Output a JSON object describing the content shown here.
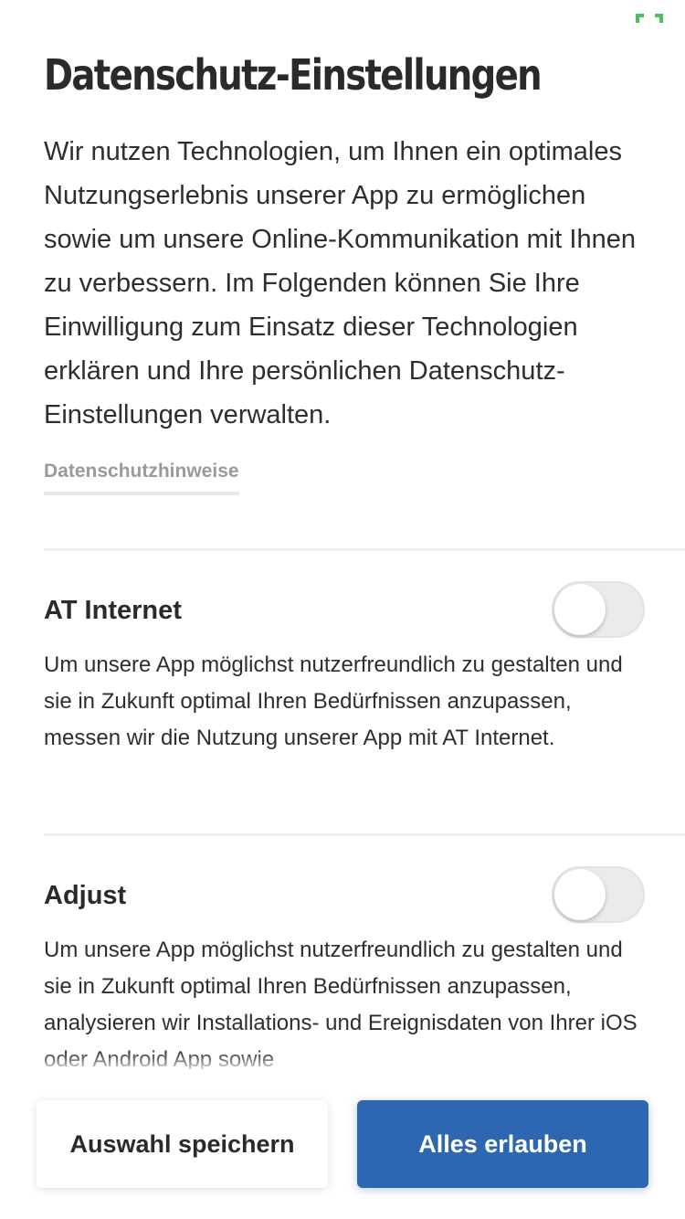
{
  "status": {
    "icon": "expand-icon",
    "color": "#4cc05a"
  },
  "page": {
    "title": "Datenschutz-Einstellungen",
    "intro": "Wir nutzen Technologien, um Ihnen ein optimales Nutzungserlebnis unserer App zu ermöglichen sowie um unsere Online-Kommunikation mit Ihnen zu verbessern. Im Folgenden können  Sie Ihre Einwilligung zum Einsatz dieser Technologien erklären und Ihre persönlichen Datenschutz-Einstellungen verwalten.",
    "privacy_link": "Datenschutzhinweise"
  },
  "sections": [
    {
      "title": "AT Internet",
      "text": "Um unsere App möglichst nutzerfreundlich zu gestalten und sie in Zukunft optimal Ihren Bedürfnissen anzupassen, messen wir die Nutzung unserer App mit AT Internet.",
      "enabled": false
    },
    {
      "title": "Adjust",
      "text": "Um unsere App möglichst nutzerfreundlich zu gestalten und sie in Zukunft optimal Ihren Bedürfnissen anzupassen, analysieren wir Installations- und Ereignisdaten von Ihrer iOS oder Android App sowie",
      "enabled": false
    }
  ],
  "footer": {
    "save_label": "Auswahl speichern",
    "allow_label": "Alles erlauben",
    "accent_color": "#2d67b2"
  }
}
